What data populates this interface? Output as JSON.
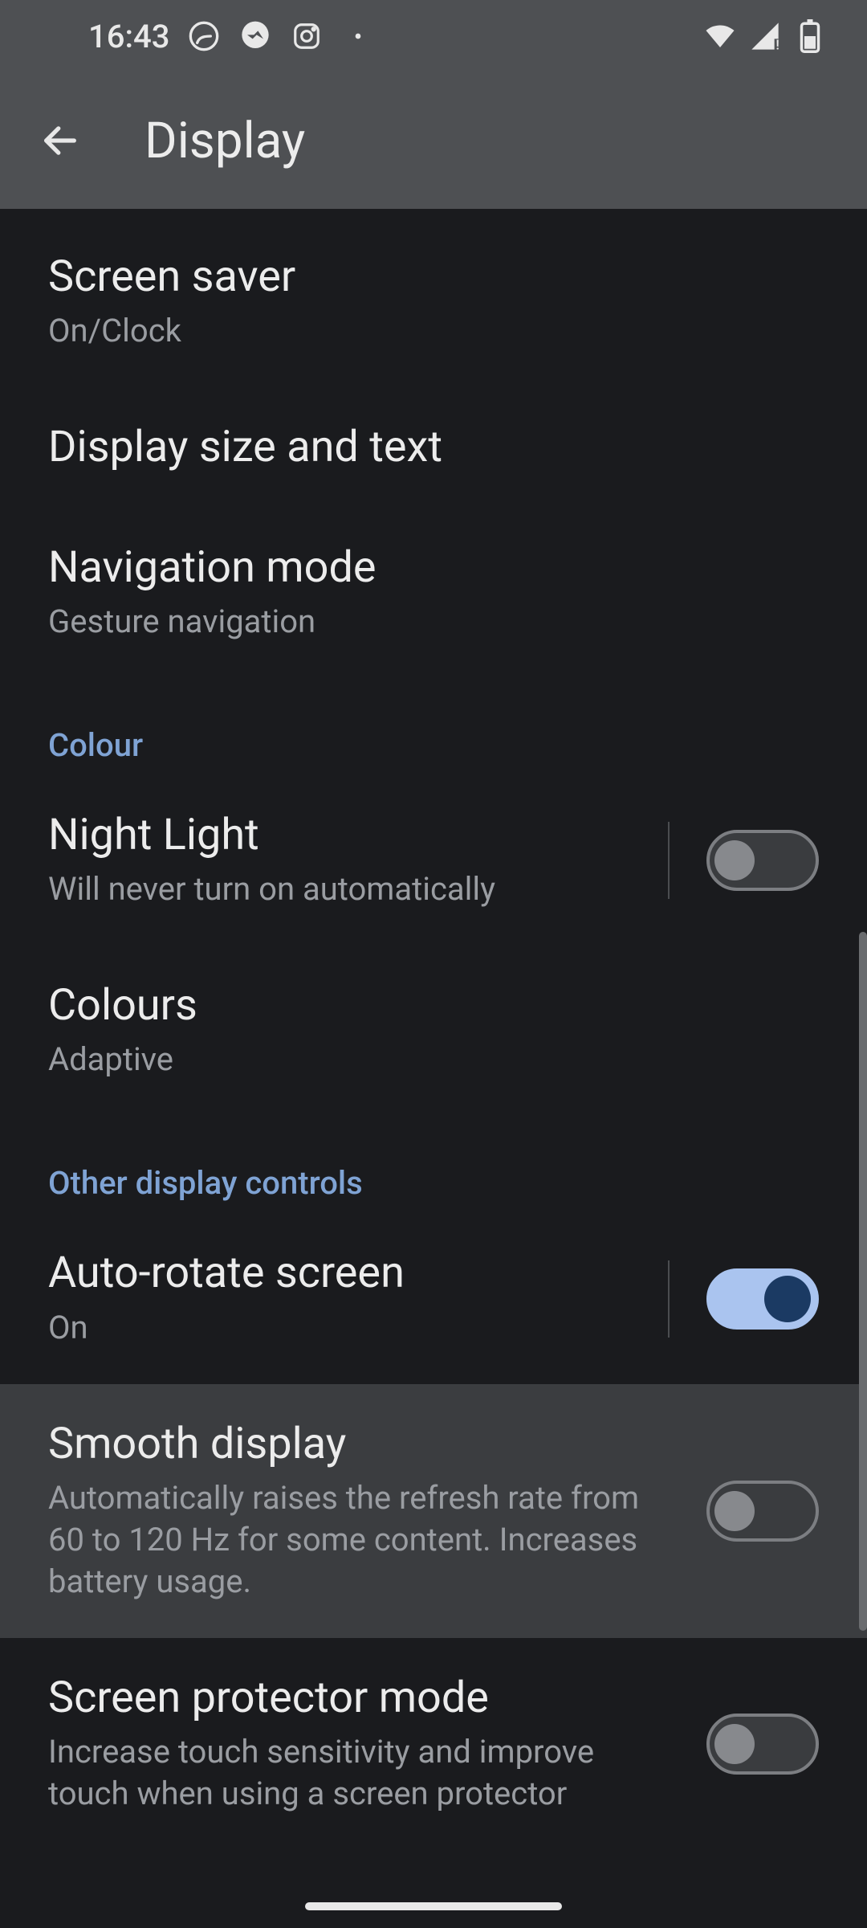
{
  "status": {
    "time": "16:43"
  },
  "appbar": {
    "title": "Display"
  },
  "items": {
    "screen_saver": {
      "title": "Screen saver",
      "sub": "On/Clock"
    },
    "display_size": {
      "title": "Display size and text"
    },
    "nav_mode": {
      "title": "Navigation mode",
      "sub": "Gesture navigation"
    },
    "night_light": {
      "title": "Night Light",
      "sub": "Will never turn on automatically"
    },
    "colours": {
      "title": "Colours",
      "sub": "Adaptive"
    },
    "auto_rotate": {
      "title": "Auto-rotate screen",
      "sub": "On"
    },
    "smooth": {
      "title": "Smooth display",
      "sub": "Automatically raises the refresh rate from 60 to 120 Hz for some content. Increases battery usage."
    },
    "protector": {
      "title": "Screen protector mode",
      "sub": "Increase touch sensitivity and improve touch when using a screen protector"
    }
  },
  "sections": {
    "colour": "Colour",
    "other": "Other display controls"
  }
}
